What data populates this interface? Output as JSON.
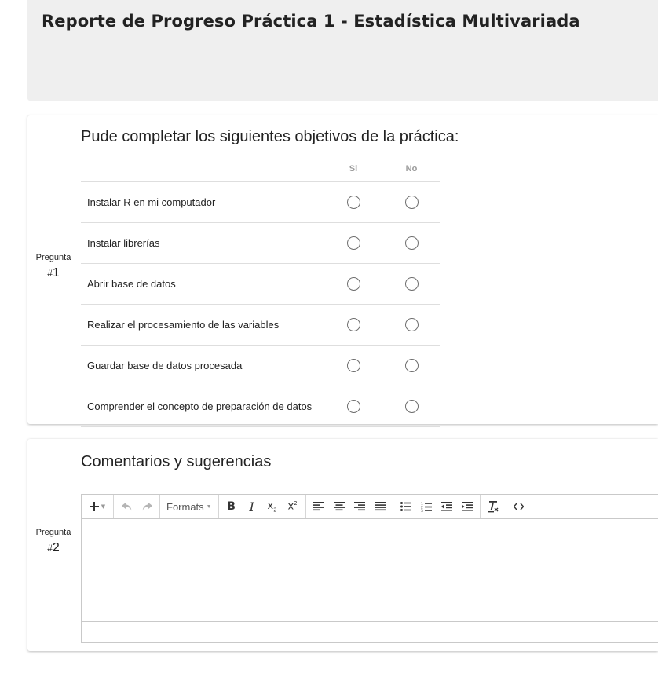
{
  "header": {
    "title": "Reporte de Progreso Práctica 1 - Estadística Multivariada"
  },
  "question1": {
    "label": "Pregunta",
    "hash": "#",
    "number": "1",
    "title": "Pude completar los siguientes objetivos de la práctica:",
    "columns": [
      "Si",
      "No"
    ],
    "rows": [
      "Instalar R en mi computador",
      "Instalar librerías",
      "Abrir base de datos",
      "Realizar el procesamiento de las variables",
      "Guardar base de datos procesada",
      "Comprender el concepto de preparación de datos"
    ]
  },
  "question2": {
    "label": "Pregunta",
    "hash": "#",
    "number": "2",
    "title": "Comentarios y sugerencias",
    "toolbar": {
      "formats_label": "Formats",
      "icons": [
        "plus-icon",
        "undo-icon",
        "redo-icon",
        "bold-icon",
        "italic-icon",
        "subscript-icon",
        "superscript-icon",
        "align-left-icon",
        "align-center-icon",
        "align-right-icon",
        "align-justify-icon",
        "bullet-list-icon",
        "numbered-list-icon",
        "outdent-icon",
        "indent-icon",
        "clear-formatting-icon",
        "source-code-icon"
      ]
    },
    "content": ""
  }
}
